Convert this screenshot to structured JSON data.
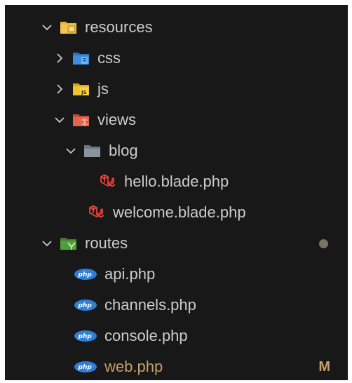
{
  "tree": {
    "resources": {
      "label": "resources"
    },
    "css": {
      "label": "css"
    },
    "js": {
      "label": "js"
    },
    "views": {
      "label": "views"
    },
    "blog": {
      "label": "blog"
    },
    "hello": {
      "label": "hello.blade.php"
    },
    "welcome": {
      "label": "welcome.blade.php"
    },
    "routes": {
      "label": "routes"
    },
    "api": {
      "label": "api.php"
    },
    "channels": {
      "label": "channels.php"
    },
    "console": {
      "label": "console.php"
    },
    "web": {
      "label": "web.php",
      "badge": "M"
    }
  },
  "colors": {
    "background": "#181818",
    "text": "#cccccc",
    "modified_badge": "#c5a06a",
    "changed_dot": "#7a7467",
    "folder_yellow": "#e8b43c",
    "folder_css_blue": "#3d8fe0",
    "folder_views_red": "#e2654e",
    "folder_blog_gray": "#8a949c",
    "folder_routes_green": "#4fa03b",
    "laravel_red": "#f0443a",
    "php_blue": "#2f7fd6"
  },
  "icons": {
    "resources": "folder-resources-icon",
    "css": "folder-css-icon",
    "js": "folder-js-icon",
    "views": "folder-views-icon",
    "blog": "folder-icon",
    "blade": "laravel-blade-icon",
    "routes": "folder-routes-icon",
    "php": "php-icon"
  }
}
